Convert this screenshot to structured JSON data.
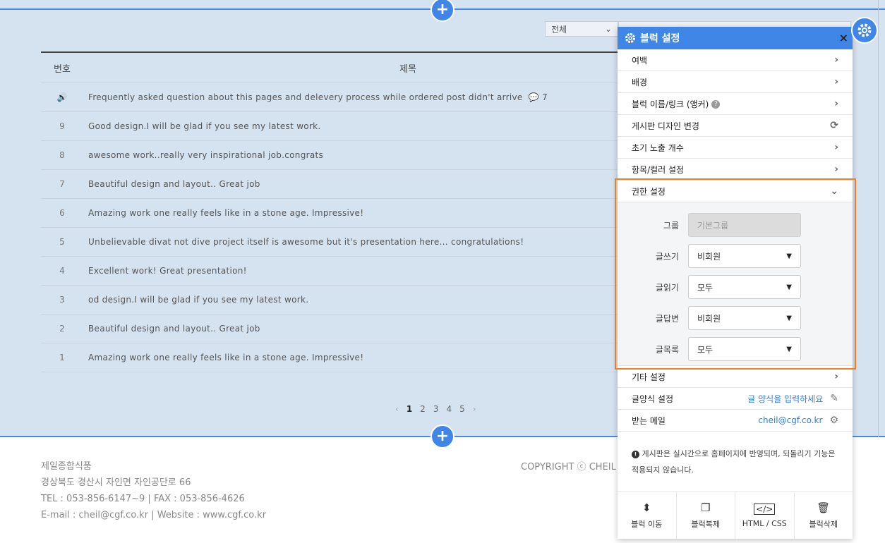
{
  "board": {
    "filter_select": "전체",
    "columns": {
      "num": "번호",
      "title": "제목"
    },
    "rows": [
      {
        "num": "🔊",
        "title": "Frequently asked question about this pages and delevery process while ordered post didn't arrive",
        "comments": "7"
      },
      {
        "num": "9",
        "title": "Good design.I will be glad if you see my latest work."
      },
      {
        "num": "8",
        "title": "awesome work..really very inspirational job.congrats"
      },
      {
        "num": "7",
        "title": "Beautiful design and layout.. Great job"
      },
      {
        "num": "6",
        "title": "Amazing work one really feels like in a stone age. Impressive!"
      },
      {
        "num": "5",
        "title": "Unbelievable divat not dive project itself is awesome but it's presentation here... congratulations!"
      },
      {
        "num": "4",
        "title": "Excellent work! Great presentation!"
      },
      {
        "num": "3",
        "title": "od design.I will be glad if you see my latest work."
      },
      {
        "num": "2",
        "title": "Beautiful design and layout.. Great job"
      },
      {
        "num": "1",
        "title": "Amazing work one really feels like in a stone age. Impressive!"
      }
    ],
    "pagination": {
      "prev": "‹",
      "pages": [
        "1",
        "2",
        "3",
        "4",
        "5"
      ],
      "next": "›"
    }
  },
  "footer": {
    "company": "제일종합식품",
    "address": "경상북도 경산시 자인면 자인공단로 66",
    "tel": "TEL : 053-856-6147~9  |  FAX : 053-856-4626",
    "email": "E-mail : cheil@cgf.co.kr  |  Website : www.cgf.co.kr",
    "copyright": "COPYRIGHT ⓒ CHEIL"
  },
  "panel": {
    "title": "블럭 설정",
    "close": "×",
    "menu": [
      {
        "label": "여백"
      },
      {
        "label": "배경"
      },
      {
        "label": "블럭 이름/링크 (앵커)"
      },
      {
        "label": "게시판 디자인 변경"
      },
      {
        "label": "초기 노출 개수"
      },
      {
        "label": "항목/컬러 설정"
      },
      {
        "label": "권한 설정"
      }
    ],
    "permissions": {
      "group_label": "그룹",
      "group_value": "기본그룹",
      "write_label": "글쓰기",
      "write_value": "비회원",
      "read_label": "글읽기",
      "read_value": "모두",
      "reply_label": "글답변",
      "reply_value": "비회원",
      "list_label": "글목록",
      "list_value": "모두"
    },
    "other": "기타 설정",
    "format_label": "글양식 설정",
    "format_link": "글 양식을 입력하세요",
    "mail_label": "받는 메일",
    "mail_link": "cheil@cgf.co.kr",
    "notice": "게시판은 실시간으로 홈페이지에 반영되며, 되돌리기 기능은 적용되지 않습니다.",
    "actions": {
      "move": "블럭 이동",
      "copy": "블럭복제",
      "html": "HTML / CSS",
      "delete": "블럭삭제"
    }
  },
  "colors": {
    "accent": "#3f86e6",
    "highlight": "#f47c1f",
    "board_bg": "#d5e2ef"
  }
}
